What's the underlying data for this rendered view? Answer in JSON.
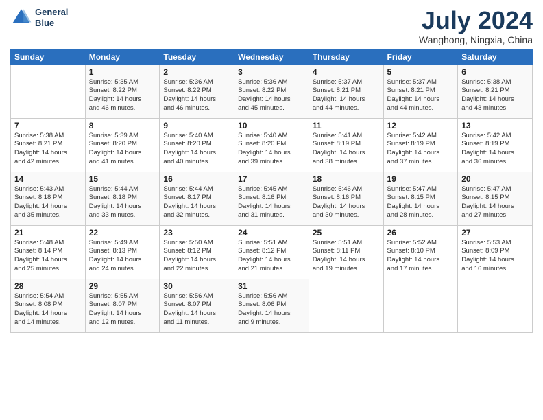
{
  "header": {
    "logo_line1": "General",
    "logo_line2": "Blue",
    "month": "July 2024",
    "location": "Wanghong, Ningxia, China"
  },
  "weekdays": [
    "Sunday",
    "Monday",
    "Tuesday",
    "Wednesday",
    "Thursday",
    "Friday",
    "Saturday"
  ],
  "weeks": [
    [
      {
        "day": "",
        "info": ""
      },
      {
        "day": "1",
        "info": "Sunrise: 5:35 AM\nSunset: 8:22 PM\nDaylight: 14 hours\nand 46 minutes."
      },
      {
        "day": "2",
        "info": "Sunrise: 5:36 AM\nSunset: 8:22 PM\nDaylight: 14 hours\nand 46 minutes."
      },
      {
        "day": "3",
        "info": "Sunrise: 5:36 AM\nSunset: 8:22 PM\nDaylight: 14 hours\nand 45 minutes."
      },
      {
        "day": "4",
        "info": "Sunrise: 5:37 AM\nSunset: 8:21 PM\nDaylight: 14 hours\nand 44 minutes."
      },
      {
        "day": "5",
        "info": "Sunrise: 5:37 AM\nSunset: 8:21 PM\nDaylight: 14 hours\nand 44 minutes."
      },
      {
        "day": "6",
        "info": "Sunrise: 5:38 AM\nSunset: 8:21 PM\nDaylight: 14 hours\nand 43 minutes."
      }
    ],
    [
      {
        "day": "7",
        "info": "Sunrise: 5:38 AM\nSunset: 8:21 PM\nDaylight: 14 hours\nand 42 minutes."
      },
      {
        "day": "8",
        "info": "Sunrise: 5:39 AM\nSunset: 8:20 PM\nDaylight: 14 hours\nand 41 minutes."
      },
      {
        "day": "9",
        "info": "Sunrise: 5:40 AM\nSunset: 8:20 PM\nDaylight: 14 hours\nand 40 minutes."
      },
      {
        "day": "10",
        "info": "Sunrise: 5:40 AM\nSunset: 8:20 PM\nDaylight: 14 hours\nand 39 minutes."
      },
      {
        "day": "11",
        "info": "Sunrise: 5:41 AM\nSunset: 8:19 PM\nDaylight: 14 hours\nand 38 minutes."
      },
      {
        "day": "12",
        "info": "Sunrise: 5:42 AM\nSunset: 8:19 PM\nDaylight: 14 hours\nand 37 minutes."
      },
      {
        "day": "13",
        "info": "Sunrise: 5:42 AM\nSunset: 8:19 PM\nDaylight: 14 hours\nand 36 minutes."
      }
    ],
    [
      {
        "day": "14",
        "info": "Sunrise: 5:43 AM\nSunset: 8:18 PM\nDaylight: 14 hours\nand 35 minutes."
      },
      {
        "day": "15",
        "info": "Sunrise: 5:44 AM\nSunset: 8:18 PM\nDaylight: 14 hours\nand 33 minutes."
      },
      {
        "day": "16",
        "info": "Sunrise: 5:44 AM\nSunset: 8:17 PM\nDaylight: 14 hours\nand 32 minutes."
      },
      {
        "day": "17",
        "info": "Sunrise: 5:45 AM\nSunset: 8:16 PM\nDaylight: 14 hours\nand 31 minutes."
      },
      {
        "day": "18",
        "info": "Sunrise: 5:46 AM\nSunset: 8:16 PM\nDaylight: 14 hours\nand 30 minutes."
      },
      {
        "day": "19",
        "info": "Sunrise: 5:47 AM\nSunset: 8:15 PM\nDaylight: 14 hours\nand 28 minutes."
      },
      {
        "day": "20",
        "info": "Sunrise: 5:47 AM\nSunset: 8:15 PM\nDaylight: 14 hours\nand 27 minutes."
      }
    ],
    [
      {
        "day": "21",
        "info": "Sunrise: 5:48 AM\nSunset: 8:14 PM\nDaylight: 14 hours\nand 25 minutes."
      },
      {
        "day": "22",
        "info": "Sunrise: 5:49 AM\nSunset: 8:13 PM\nDaylight: 14 hours\nand 24 minutes."
      },
      {
        "day": "23",
        "info": "Sunrise: 5:50 AM\nSunset: 8:12 PM\nDaylight: 14 hours\nand 22 minutes."
      },
      {
        "day": "24",
        "info": "Sunrise: 5:51 AM\nSunset: 8:12 PM\nDaylight: 14 hours\nand 21 minutes."
      },
      {
        "day": "25",
        "info": "Sunrise: 5:51 AM\nSunset: 8:11 PM\nDaylight: 14 hours\nand 19 minutes."
      },
      {
        "day": "26",
        "info": "Sunrise: 5:52 AM\nSunset: 8:10 PM\nDaylight: 14 hours\nand 17 minutes."
      },
      {
        "day": "27",
        "info": "Sunrise: 5:53 AM\nSunset: 8:09 PM\nDaylight: 14 hours\nand 16 minutes."
      }
    ],
    [
      {
        "day": "28",
        "info": "Sunrise: 5:54 AM\nSunset: 8:08 PM\nDaylight: 14 hours\nand 14 minutes."
      },
      {
        "day": "29",
        "info": "Sunrise: 5:55 AM\nSunset: 8:07 PM\nDaylight: 14 hours\nand 12 minutes."
      },
      {
        "day": "30",
        "info": "Sunrise: 5:56 AM\nSunset: 8:07 PM\nDaylight: 14 hours\nand 11 minutes."
      },
      {
        "day": "31",
        "info": "Sunrise: 5:56 AM\nSunset: 8:06 PM\nDaylight: 14 hours\nand 9 minutes."
      },
      {
        "day": "",
        "info": ""
      },
      {
        "day": "",
        "info": ""
      },
      {
        "day": "",
        "info": ""
      }
    ]
  ]
}
